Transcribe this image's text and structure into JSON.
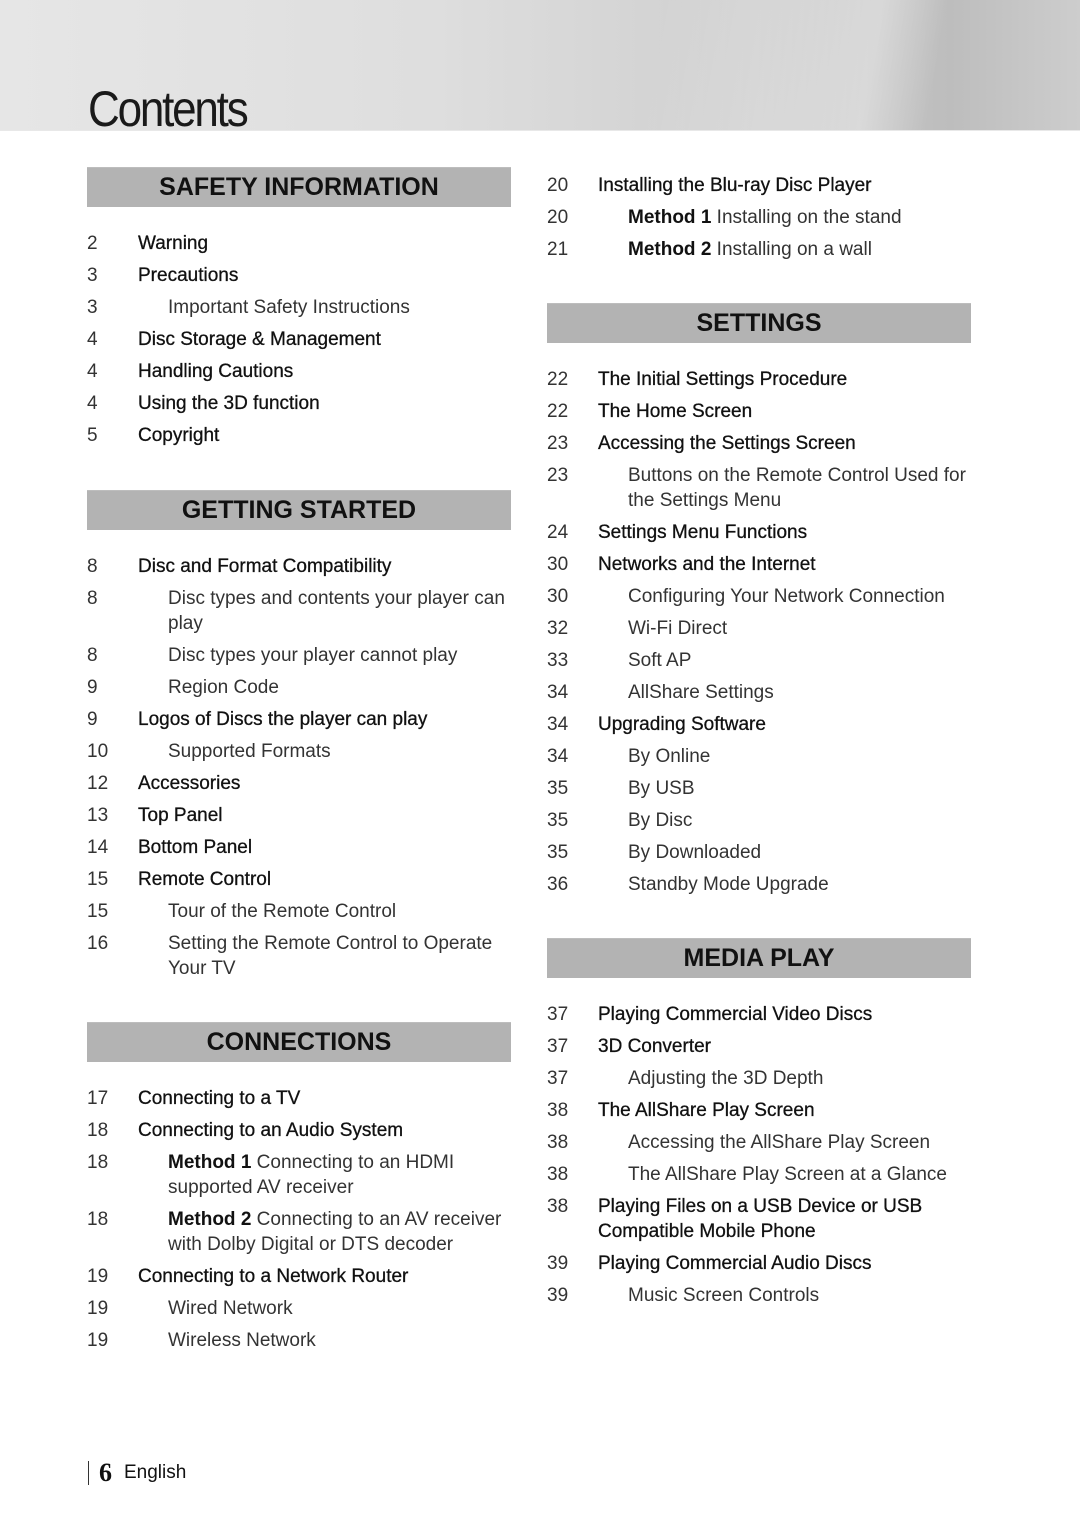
{
  "title": "Contents",
  "sections": {
    "safety": {
      "header": "SAFETY INFORMATION",
      "entries": [
        {
          "page": "2",
          "text": "Warning"
        },
        {
          "page": "3",
          "text": "Precautions"
        },
        {
          "page": "3",
          "text": "Important Safety Instructions"
        },
        {
          "page": "4",
          "text": "Disc Storage & Management"
        },
        {
          "page": "4",
          "text": "Handling Cautions"
        },
        {
          "page": "4",
          "text": "Using the 3D function"
        },
        {
          "page": "5",
          "text": "Copyright"
        }
      ]
    },
    "getting_started": {
      "header": "GETTING STARTED",
      "entries": [
        {
          "page": "8",
          "text": "Disc and Format Compatibility"
        },
        {
          "page": "8",
          "text": "Disc types and contents your player can play"
        },
        {
          "page": "8",
          "text": "Disc types your player cannot play"
        },
        {
          "page": "9",
          "text": "Region Code"
        },
        {
          "page": "9",
          "text": "Logos of Discs the player can play"
        },
        {
          "page": "10",
          "text": "Supported Formats"
        },
        {
          "page": "12",
          "text": "Accessories"
        },
        {
          "page": "13",
          "text": "Top Panel"
        },
        {
          "page": "14",
          "text": "Bottom Panel"
        },
        {
          "page": "15",
          "text": "Remote Control"
        },
        {
          "page": "15",
          "text": "Tour of the Remote Control"
        },
        {
          "page": "16",
          "text": "Setting the Remote Control to Operate Your TV"
        }
      ]
    },
    "connections": {
      "header": "CONNECTIONS",
      "entries": [
        {
          "page": "17",
          "text": "Connecting to a TV"
        },
        {
          "page": "18",
          "text": "Connecting to an Audio System"
        },
        {
          "page": "18",
          "prefix": "Method 1",
          "text": "Connecting to an HDMI supported AV receiver"
        },
        {
          "page": "18",
          "prefix": "Method 2",
          "text": "Connecting to an AV receiver with Dolby Digital or DTS decoder"
        },
        {
          "page": "19",
          "text": "Connecting to a Network Router"
        },
        {
          "page": "19",
          "text": "Wired Network"
        },
        {
          "page": "19",
          "text": "Wireless Network"
        },
        {
          "page": "20",
          "text": "Installing the Blu-ray Disc Player"
        },
        {
          "page": "20",
          "prefix": "Method 1",
          "text": "Installing on the stand"
        },
        {
          "page": "21",
          "prefix": "Method 2",
          "text": "Installing on a wall"
        }
      ]
    },
    "settings": {
      "header": "SETTINGS",
      "entries": [
        {
          "page": "22",
          "text": "The Initial Settings Procedure"
        },
        {
          "page": "22",
          "text": "The Home Screen"
        },
        {
          "page": "23",
          "text": "Accessing the Settings Screen"
        },
        {
          "page": "23",
          "text": "Buttons on the Remote Control Used for the Settings Menu"
        },
        {
          "page": "24",
          "text": "Settings Menu Functions"
        },
        {
          "page": "30",
          "text": "Networks and the Internet"
        },
        {
          "page": "30",
          "text": "Configuring Your Network Connection"
        },
        {
          "page": "32",
          "text": "Wi-Fi Direct"
        },
        {
          "page": "33",
          "text": "Soft AP"
        },
        {
          "page": "34",
          "text": "AllShare Settings"
        },
        {
          "page": "34",
          "text": "Upgrading Software"
        },
        {
          "page": "34",
          "text": "By Online"
        },
        {
          "page": "35",
          "text": "By USB"
        },
        {
          "page": "35",
          "text": "By Disc"
        },
        {
          "page": "35",
          "text": "By Downloaded"
        },
        {
          "page": "36",
          "text": "Standby Mode Upgrade"
        }
      ]
    },
    "media_play": {
      "header": "MEDIA PLAY",
      "entries": [
        {
          "page": "37",
          "text": "Playing Commercial Video Discs"
        },
        {
          "page": "37",
          "text": "3D Converter"
        },
        {
          "page": "37",
          "text": "Adjusting the 3D Depth"
        },
        {
          "page": "38",
          "text": "The AllShare Play Screen"
        },
        {
          "page": "38",
          "text": "Accessing the AllShare Play Screen"
        },
        {
          "page": "38",
          "text": "The AllShare Play Screen at a Glance"
        },
        {
          "page": "38",
          "text": "Playing Files on a USB Device or USB Compatible Mobile Phone"
        },
        {
          "page": "39",
          "text": "Playing Commercial Audio Discs"
        },
        {
          "page": "39",
          "text": "Music Screen Controls"
        }
      ]
    }
  },
  "footer": {
    "page_number": "6",
    "language": "English"
  }
}
